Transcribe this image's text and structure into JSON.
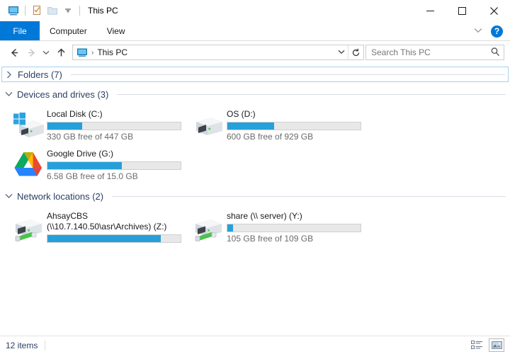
{
  "window": {
    "title": "This PC",
    "quick_access": [
      {
        "name": "this-pc-icon",
        "label": "This PC"
      },
      {
        "name": "properties-icon",
        "label": "Properties"
      },
      {
        "name": "new-folder-icon",
        "label": "New folder"
      },
      {
        "name": "customize-qat-chevron",
        "label": "Customize Quick Access Toolbar"
      }
    ],
    "controls": {
      "minimize": "—",
      "maximize": "☐",
      "close": "✕"
    }
  },
  "ribbon": {
    "tabs": [
      {
        "label": "File",
        "active": true
      },
      {
        "label": "Computer",
        "active": false
      },
      {
        "label": "View",
        "active": false
      }
    ],
    "collapse_chevron": "⌄",
    "help_label": "?"
  },
  "address": {
    "back_label": "←",
    "forward_label": "→",
    "recent_label": "⌄",
    "up_label": "↑",
    "crumb_icon": "this-pc-icon",
    "crumb_separator": "›",
    "crumb_text": "This PC",
    "dropdown_label": "⌄",
    "refresh_label": "⟳"
  },
  "search": {
    "placeholder": "Search This PC",
    "value": "",
    "icon": "search-icon"
  },
  "groups": [
    {
      "id": "folders",
      "label": "Folders (7)",
      "expanded": false,
      "chevron": "›",
      "focused": true,
      "items": []
    },
    {
      "id": "devices",
      "label": "Devices and drives (3)",
      "expanded": true,
      "chevron": "⌄",
      "focused": false,
      "items": [
        {
          "name": "Local Disk (C:)",
          "name2": "",
          "icon": "windows-drive-icon",
          "used_percent": 26,
          "free_text": "330 GB free of 447 GB",
          "bar_color": "#26a0da"
        },
        {
          "name": "OS (D:)",
          "name2": "",
          "icon": "hard-drive-icon",
          "used_percent": 35,
          "free_text": "600 GB free of 929 GB",
          "bar_color": "#26a0da"
        },
        {
          "name": "Google Drive (G:)",
          "name2": "",
          "icon": "google-drive-icon",
          "used_percent": 56,
          "free_text": "6.58 GB free of 15.0 GB",
          "bar_color": "#26a0da"
        }
      ]
    },
    {
      "id": "network",
      "label": "Network locations (2)",
      "expanded": true,
      "chevron": "⌄",
      "focused": false,
      "items": [
        {
          "name": "AhsayCBS",
          "name2": "(\\\\10.7.140.50\\asr\\Archives) (Z:)",
          "icon": "network-drive-icon",
          "used_percent": 85,
          "free_text": "",
          "bar_color": "#26a0da"
        },
        {
          "name": "share (\\\\ server) (Y:)",
          "name2": "",
          "icon": "network-drive-icon",
          "used_percent": 4,
          "free_text": "105 GB free of 109 GB",
          "bar_color": "#26a0da"
        }
      ]
    }
  ],
  "status": {
    "items_text": "12 items",
    "view_details": "details-view-icon",
    "view_large_icons": "large-icons-view-icon"
  }
}
